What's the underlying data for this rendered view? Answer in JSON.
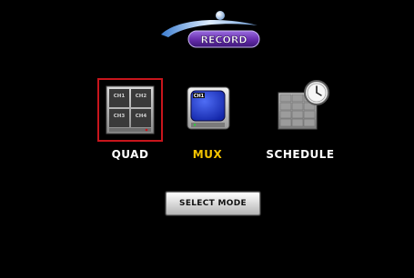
{
  "logo": {
    "text": "RECORD"
  },
  "modes": [
    {
      "id": "quad",
      "label": "QUAD",
      "selected": true,
      "label_color": "#ffffff",
      "tiles": [
        "CH1",
        "CH2",
        "CH3",
        "CH4"
      ]
    },
    {
      "id": "mux",
      "label": "MUX",
      "selected": false,
      "label_color": "#f5c400",
      "screen_text": "CH1"
    },
    {
      "id": "schedule",
      "label": "SCHEDULE",
      "selected": false,
      "label_color": "#ffffff"
    }
  ],
  "select_button": {
    "label": "SELECT MODE"
  },
  "colors": {
    "background": "#000000",
    "selection_border": "#c8151c",
    "accent_yellow": "#f5c400",
    "logo_purple": "#6a2fb0"
  }
}
